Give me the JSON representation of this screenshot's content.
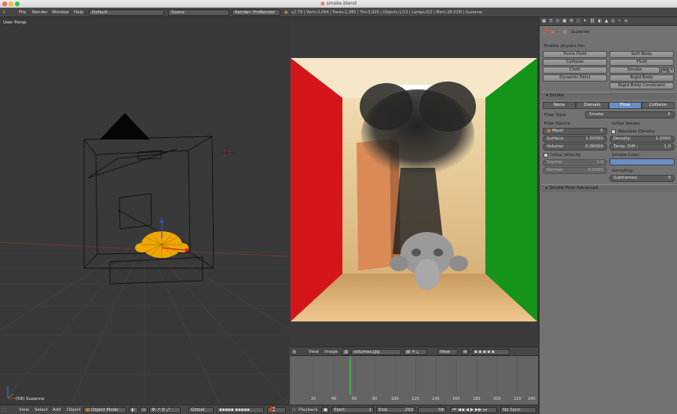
{
  "window": {
    "title": "smoke.blend"
  },
  "info_header": {
    "menus": [
      "File",
      "Render",
      "Window",
      "Help"
    ],
    "layout": "Default",
    "scene": "Scene",
    "engine": "Render: ProRender",
    "stats": "v2.79 | Verts:2,064 | Faces:1,985 | Tris:3,920 | Objects:1/13 | Lamps:0/2 | Mem:28.01M | Suzanne"
  },
  "viewport": {
    "label": "User Persp",
    "object_label": "(58) Suzanne",
    "header": {
      "menus": [
        "View",
        "Select",
        "Add",
        "Object"
      ],
      "mode": "Object Mode",
      "orientation": "Global"
    }
  },
  "image_editor": {
    "header": {
      "menus": [
        "View",
        "Image"
      ],
      "image_name": "volumes.jpg",
      "view": "View"
    }
  },
  "timeline": {
    "frames": [
      "20",
      "40",
      "60",
      "80",
      "100",
      "120",
      "140",
      "160",
      "180",
      "200",
      "220",
      "240"
    ],
    "current_frame_marker": 58,
    "header": {
      "playback": "Playback",
      "start_label": "Start:",
      "start": "1",
      "end_label": "End:",
      "end": "250",
      "current": "58",
      "sync": "No Sync"
    }
  },
  "properties": {
    "object_name": "Suzanne",
    "enable_physics_label": "Enable physics for:",
    "physics_buttons": [
      "Force Field",
      "Soft Body",
      "Collision",
      "Fluid",
      "Cloth",
      "Smoke",
      "Dynamic Paint",
      "Rigid Body",
      "",
      "Rigid Body Constraint"
    ],
    "smoke_panel": "Smoke",
    "smoke_tabs": [
      "None",
      "Domain",
      "Flow",
      "Collision"
    ],
    "flow_type_label": "Flow Type:",
    "flow_type": "Smoke",
    "flow_source_label": "Flow Source:",
    "flow_source": "Mesh",
    "initial_values_label": "Initial Values:",
    "absolute_density": "Absolute Density",
    "surface_label": "Surface:",
    "surface_value": "1.50000",
    "volume_label": "Volume:",
    "volume_value": "0.00000",
    "density_label": "Density:",
    "density_value": "1.0000",
    "temp_label": "Temp. Diff.:",
    "temp_value": "1.0",
    "initial_velocity": "Initial Velocity",
    "smoke_color_label": "Smoke Color:",
    "source_label": "Source:",
    "source_value": "1.0",
    "normal_label": "Normal:",
    "normal_value": "0.0000",
    "sampling_label": "Sampling:",
    "subframes_label": "Subframes:",
    "subframes_value": "0",
    "advanced_panel": "Smoke Flow Advanced",
    "smoke_color": "#6a8fc4"
  }
}
